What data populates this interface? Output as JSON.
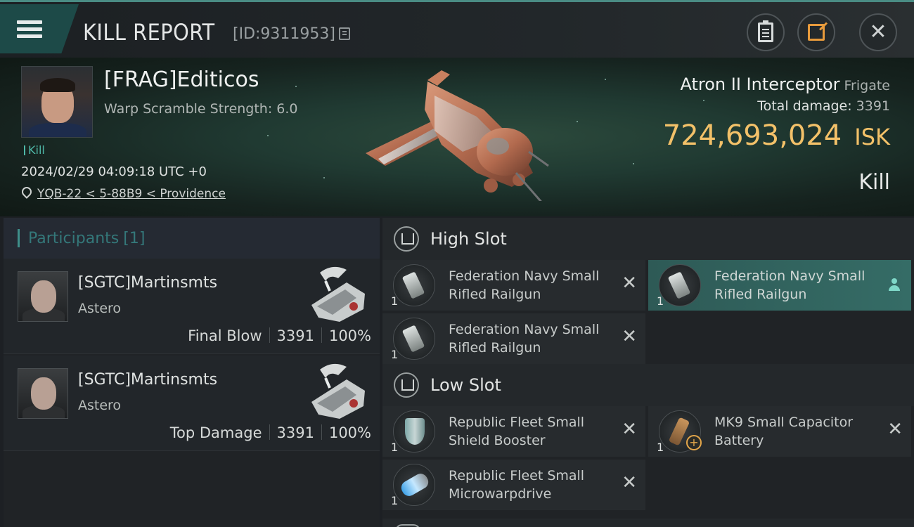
{
  "header": {
    "title": "KILL REPORT",
    "report_id": "[ID:9311953]",
    "icons": {
      "menu": "menu-icon",
      "copy": "copy-icon",
      "clipboard": "clipboard-icon",
      "share": "share-icon",
      "close": "close-icon"
    },
    "close_glyph": "✕"
  },
  "victim": {
    "name": "[FRAG]Editicos",
    "subtitle": "Warp Scramble Strength: 6.0",
    "tag": "Kill",
    "date": "2024/02/29 04:09:18 UTC +0",
    "location": "YQB-22 < 5-88B9 < Providence",
    "ship": "Atron II Interceptor",
    "ship_class": "Frigate",
    "total_damage_label": "Total damage:",
    "total_damage": "3391",
    "isk_value": "724,693,024",
    "isk_unit": "ISK",
    "result": "Kill"
  },
  "participants": {
    "label": "Participants",
    "count": "[1]",
    "rows": [
      {
        "name": "[SGTC]Martinsmts",
        "ship": "Astero",
        "role": "Final Blow",
        "damage": "3391",
        "percent": "100%"
      },
      {
        "name": "[SGTC]Martinsmts",
        "ship": "Astero",
        "role": "Top Damage",
        "damage": "3391",
        "percent": "100%"
      }
    ]
  },
  "slots": {
    "high": {
      "label": "High Slot",
      "items": [
        {
          "name": "Federation Navy Small Rifled Railgun",
          "qty": "1",
          "icon": "railgun-icon"
        },
        {
          "name": "Federation Navy Small Rifled Railgun",
          "qty": "1",
          "icon": "railgun-icon"
        },
        {
          "name": "Federation Navy Small Rifled Railgun",
          "qty": "1",
          "icon": "railgun-icon"
        }
      ]
    },
    "low": {
      "label": "Low Slot",
      "items": [
        {
          "name": "Republic Fleet Small Shield Booster",
          "qty": "1",
          "icon": "shield-booster-icon"
        },
        {
          "name": "MK9 Small Capacitor Battery",
          "qty": "1",
          "icon": "capacitor-battery-icon"
        },
        {
          "name": "Republic Fleet Small Microwarpdrive",
          "qty": "1",
          "icon": "microwarpdrive-icon"
        }
      ]
    },
    "remove_glyph": "✕",
    "plus_glyph": "+"
  },
  "colors": {
    "accent": "#3f8f8a",
    "isk": "#f3c169",
    "selected": "#356c66"
  }
}
